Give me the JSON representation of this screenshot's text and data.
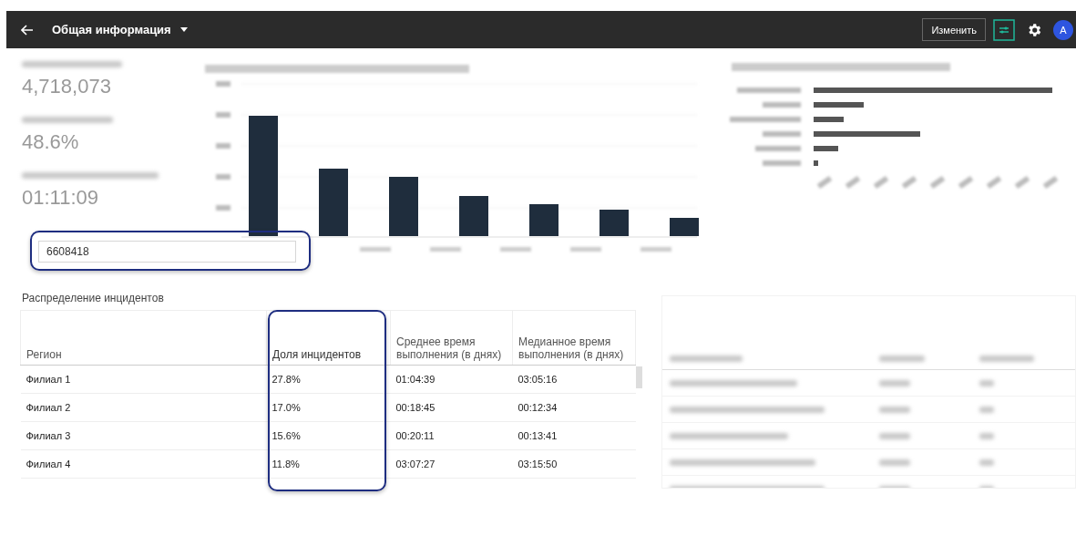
{
  "header": {
    "title": "Общая информация",
    "edit_button": "Изменить",
    "avatar": "A"
  },
  "kpis": [
    {
      "value": "4,718,073"
    },
    {
      "value": "48.6%"
    },
    {
      "value": "01:11:09"
    }
  ],
  "filter_field": {
    "value": "6608418",
    "highlighted": true
  },
  "table": {
    "title": "Распределение инцидентов",
    "columns": [
      {
        "label": "Регион",
        "highlighted": false
      },
      {
        "label": "Доля инцидентов",
        "highlighted": true
      },
      {
        "label": "Среднее время выполнения (в днях)",
        "highlighted": false
      },
      {
        "label": "Медианное время выполнения (в днях)",
        "highlighted": false
      }
    ],
    "rows": [
      [
        "Филиал 1",
        "27.8%",
        "01:04:39",
        "03:05:16"
      ],
      [
        "Филиал 2",
        "17.0%",
        "00:18:45",
        "00:12:34"
      ],
      [
        "Филиал 3",
        "15.6%",
        "00:20:11",
        "00:13:41"
      ],
      [
        "Филиал 4",
        "11.8%",
        "03:07:27",
        "03:15:50"
      ]
    ]
  }
}
